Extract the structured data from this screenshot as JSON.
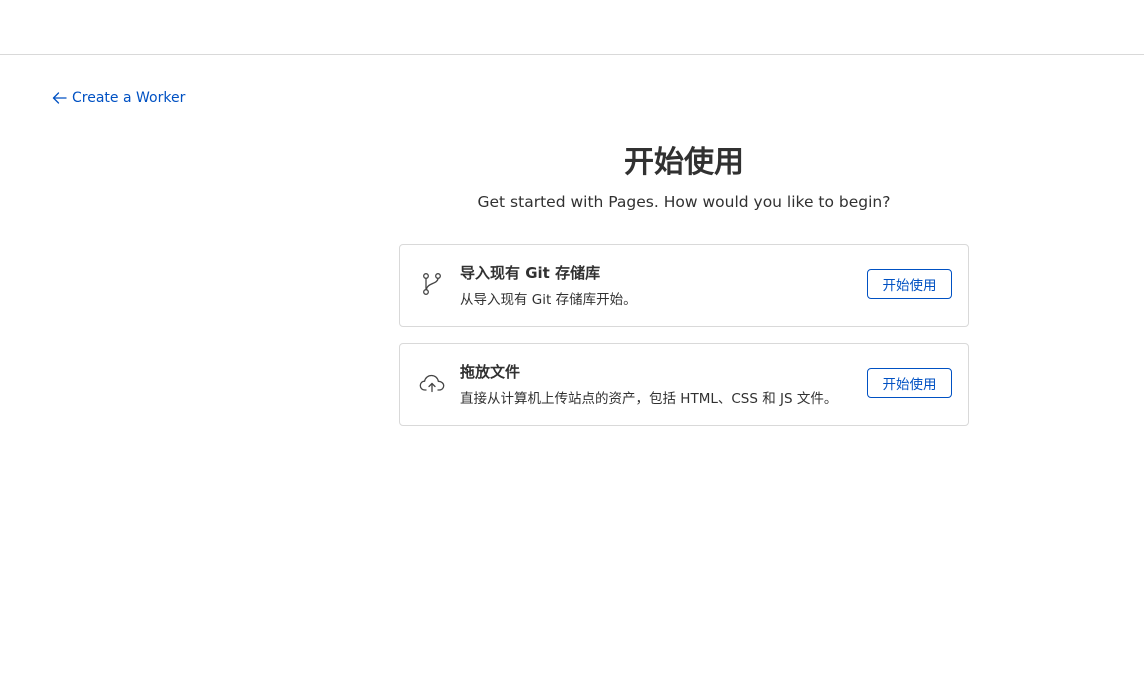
{
  "header": {},
  "back_link": {
    "label": "Create a Worker",
    "icon": "arrow-left-icon"
  },
  "page": {
    "title": "开始使用",
    "subtitle": "Get started with Pages. How would you like to begin?"
  },
  "options": [
    {
      "icon": "git-branch-icon",
      "title": "导入现有 Git 存储库",
      "description": "从导入现有 Git 存储库开始。",
      "button_label": "开始使用"
    },
    {
      "icon": "cloud-upload-icon",
      "title": "拖放文件",
      "description": "直接从计算机上传站点的资产，包括 HTML、CSS 和 JS 文件。",
      "button_label": "开始使用"
    }
  ],
  "colors": {
    "accent": "#0051c3",
    "text": "#313131",
    "border": "#d9d9d9"
  }
}
